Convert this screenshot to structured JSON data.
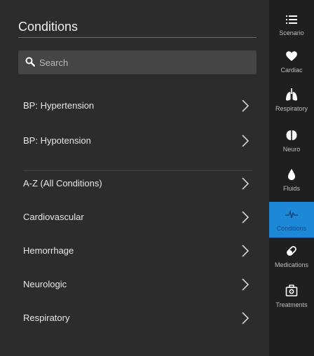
{
  "panel": {
    "title": "Conditions",
    "search": {
      "placeholder": "Search"
    },
    "top_items": [
      {
        "label": "BP: Hypertension"
      },
      {
        "label": "BP: Hypotension"
      }
    ],
    "categories": [
      {
        "label": "A-Z (All Conditions)"
      },
      {
        "label": "Cardiovascular"
      },
      {
        "label": "Hemorrhage"
      },
      {
        "label": "Neurologic"
      },
      {
        "label": "Respiratory"
      }
    ]
  },
  "sidebar": {
    "items": [
      {
        "label": "Scenario",
        "icon": "list-icon"
      },
      {
        "label": "Cardiac",
        "icon": "heart-icon"
      },
      {
        "label": "Respiratory",
        "icon": "lungs-icon"
      },
      {
        "label": "Neuro",
        "icon": "brain-icon"
      },
      {
        "label": "Fluids",
        "icon": "drop-icon"
      },
      {
        "label": "Conditions",
        "icon": "pulse-icon",
        "active": true
      },
      {
        "label": "Medications",
        "icon": "pill-icon"
      },
      {
        "label": "Treatments",
        "icon": "medkit-icon"
      }
    ],
    "active_color": "#1e88d8"
  }
}
